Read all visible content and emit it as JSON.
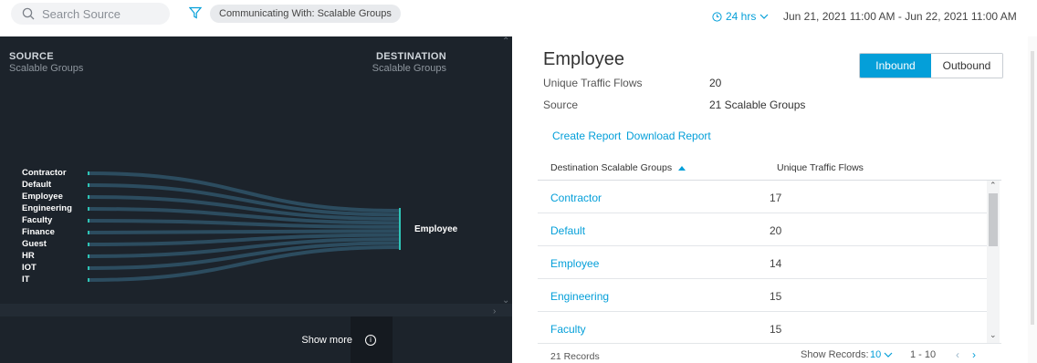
{
  "search": {
    "placeholder": "Search Source"
  },
  "filter": {
    "chip_label": "Communicating With: Scalable Groups"
  },
  "time": {
    "range_label": "24 hrs",
    "date_range": "Jun 21, 2021 11:00 AM - Jun 22, 2021 11:00 AM"
  },
  "viz": {
    "source_title": "SOURCE",
    "source_subtitle": "Scalable Groups",
    "destination_title": "DESTINATION",
    "destination_subtitle": "Scalable Groups",
    "sources": [
      "Contractor",
      "Default",
      "Employee",
      "Engineering",
      "Faculty",
      "Finance",
      "Guest",
      "HR",
      "IOT",
      "IT"
    ],
    "destination": "Employee",
    "show_more": "Show more",
    "info_glyph": "i",
    "colors": {
      "background": "#1c232b",
      "flow": "#2f5369",
      "node": "#2ec4b6"
    }
  },
  "detail": {
    "title": "Employee",
    "toggle": {
      "inbound": "Inbound",
      "outbound": "Outbound"
    },
    "unique_flows_label": "Unique Traffic Flows",
    "unique_flows_value": "20",
    "source_label": "Source",
    "source_value": "21  Scalable Groups",
    "create_report": "Create Report",
    "download_report": "Download Report",
    "columns": {
      "group": "Destination Scalable Groups",
      "flows": "Unique Traffic Flows"
    },
    "rows": [
      {
        "group": "Contractor",
        "flows": "17"
      },
      {
        "group": "Default",
        "flows": "20"
      },
      {
        "group": "Employee",
        "flows": "14"
      },
      {
        "group": "Engineering",
        "flows": "15"
      },
      {
        "group": "Faculty",
        "flows": "15"
      }
    ],
    "records": "21 Records",
    "show_records_label": "Show Records:",
    "show_records_value": "10",
    "page_range": "1 - 10"
  },
  "accent_color": "#049fd9"
}
